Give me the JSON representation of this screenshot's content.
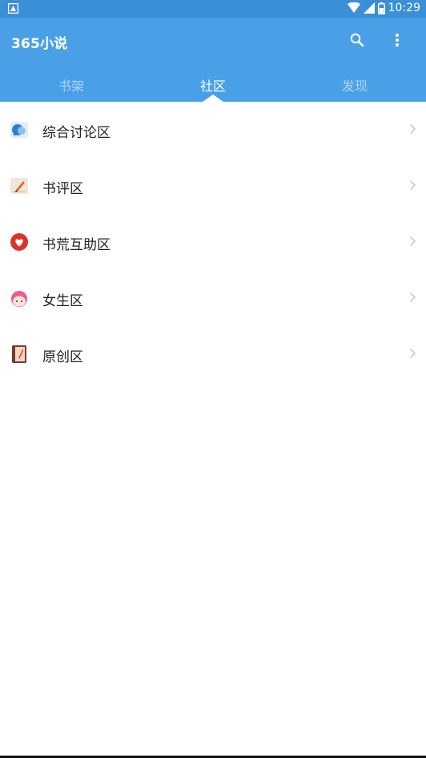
{
  "status_bar": {
    "time": "10:29",
    "icons": [
      "notification-icon",
      "wifi-icon",
      "signal-icon",
      "battery-icon"
    ]
  },
  "app_bar": {
    "title": "365小说",
    "actions": [
      "search-icon",
      "more-vert-icon"
    ],
    "color": "#4aa0e6"
  },
  "tabs": [
    {
      "label": "书架",
      "active": false
    },
    {
      "label": "社区",
      "active": true
    },
    {
      "label": "发现",
      "active": false
    }
  ],
  "community_list": [
    {
      "label": "综合讨论区",
      "icon": "chat-bubbles-icon"
    },
    {
      "label": "书评区",
      "icon": "pencil-paper-icon"
    },
    {
      "label": "书荒互助区",
      "icon": "heart-icon"
    },
    {
      "label": "女生区",
      "icon": "girl-face-icon"
    },
    {
      "label": "原创区",
      "icon": "book-icon"
    }
  ]
}
